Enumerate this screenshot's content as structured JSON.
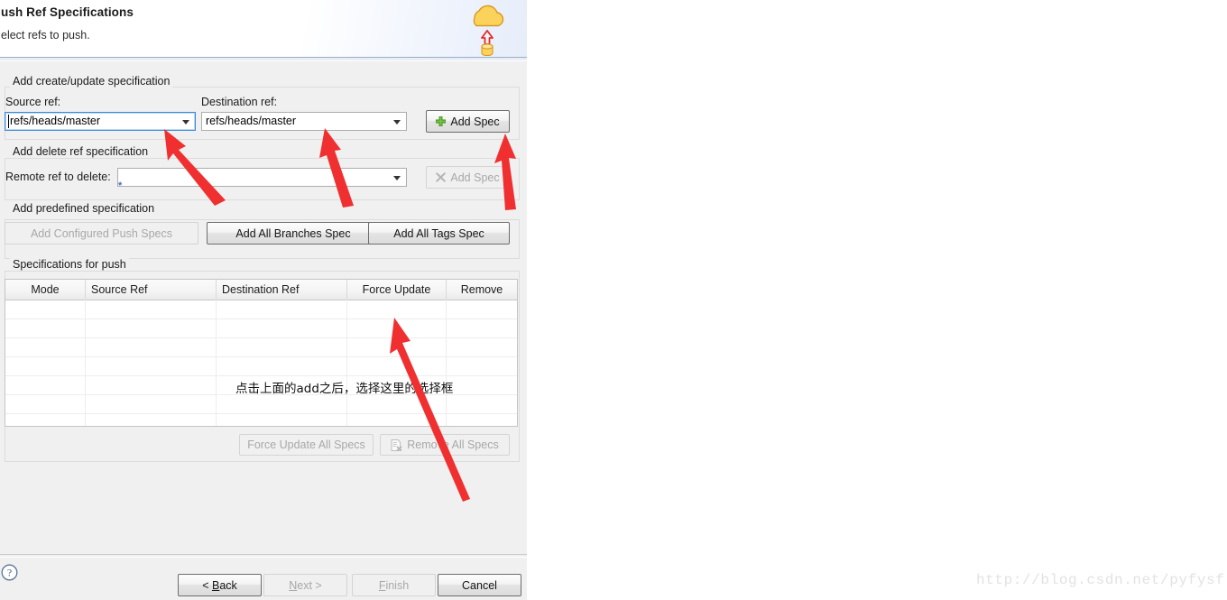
{
  "banner": {
    "title": "ush Ref Specifications",
    "subtitle": "elect refs to push.",
    "icon": "cloud-push-icon"
  },
  "create_update_group": {
    "title": "Add create/update specification",
    "source_label": "Source ref:",
    "source_value": "refs/heads/master",
    "destination_label": "Destination ref:",
    "destination_value": "refs/heads/master",
    "add_spec_label": "Add Spec",
    "add_spec_icon": "green-plus-icon"
  },
  "delete_group": {
    "title": "Add delete ref specification",
    "remote_label": "Remote ref to delete:",
    "remote_value": "",
    "required_marker": "*",
    "add_spec_label": "Add Spec",
    "add_spec_icon": "grey-x-icon"
  },
  "predefined_group": {
    "title": "Add predefined specification",
    "buttons": [
      {
        "label": "Add Configured Push Specs",
        "enabled": false
      },
      {
        "label": "Add All Branches Spec",
        "enabled": true
      },
      {
        "label": "Add All Tags Spec",
        "enabled": true
      }
    ]
  },
  "specs_group": {
    "title": "Specifications for push",
    "columns": [
      "Mode",
      "Source Ref",
      "Destination Ref",
      "Force Update",
      "Remove"
    ],
    "rows": [],
    "annotation": "点击上面的add之后，选择这里的选择框",
    "actions": [
      {
        "label": "Force Update All Specs",
        "enabled": false,
        "icon": "none"
      },
      {
        "label": "Remove All Specs",
        "enabled": false,
        "icon": "remove-doc-icon"
      }
    ]
  },
  "footer": {
    "help_icon": "help-question-icon",
    "buttons": [
      {
        "label": "< Back",
        "accel": "B",
        "enabled": true
      },
      {
        "label": "Next >",
        "accel": "N",
        "enabled": false
      },
      {
        "label": "Finish",
        "accel": "F",
        "enabled": false
      },
      {
        "label": "Cancel",
        "accel": "",
        "enabled": true
      }
    ]
  },
  "watermark": {
    "text": "http://blog.csdn.net/pyfysf"
  },
  "annotation_color": "#f03030"
}
